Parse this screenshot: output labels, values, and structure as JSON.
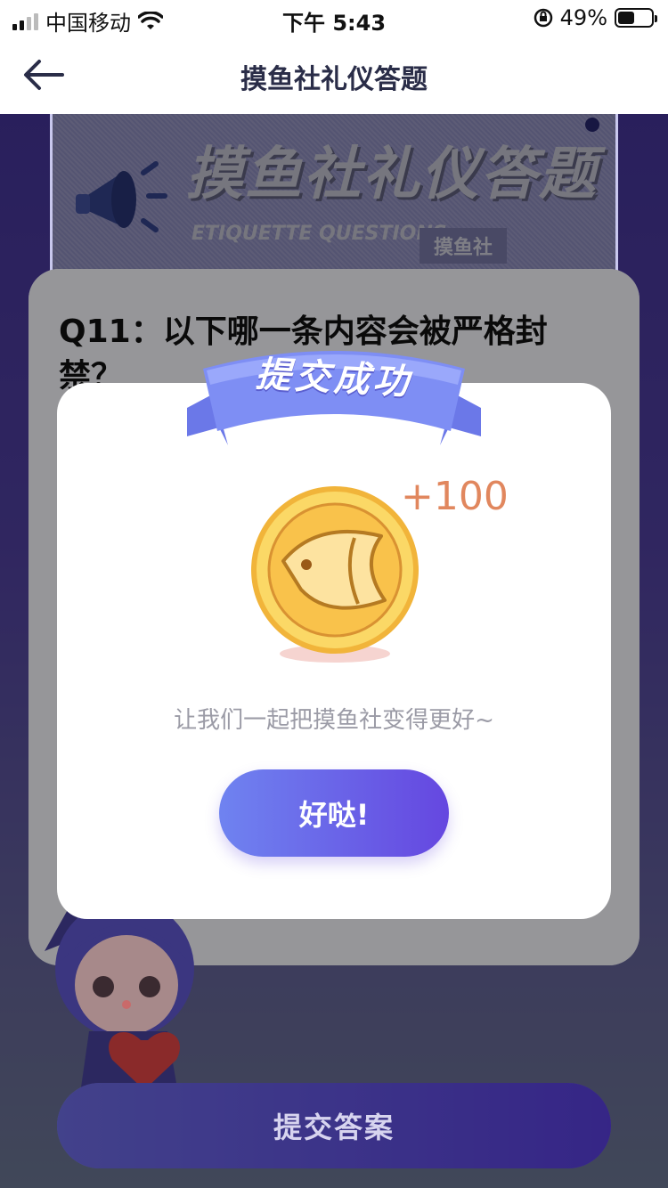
{
  "status_bar": {
    "carrier": "中国移动",
    "time": "下午 5:43",
    "battery": "49%",
    "battery_level": 0.49
  },
  "nav": {
    "title": "摸鱼社礼仪答题"
  },
  "banner": {
    "title": "摸鱼社礼仪答题",
    "subtitle": "ETIQUETTE QUESTIONS",
    "tag": "摸鱼社"
  },
  "question": {
    "text": "Q11：以下哪一条内容会被严格封禁？"
  },
  "submit": {
    "label": "提交答案"
  },
  "modal": {
    "ribbon": "提交成功",
    "bonus": "+100",
    "message": "让我们一起把摸鱼社变得更好~",
    "confirm_label": "好哒!"
  },
  "colors": {
    "accent": "#6547e0",
    "bonus": "#e1875e",
    "coin": "#f5c542"
  }
}
